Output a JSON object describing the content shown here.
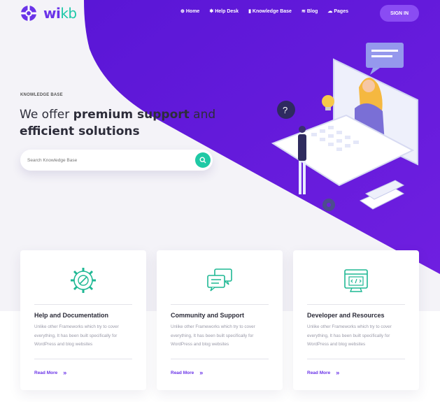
{
  "brand": {
    "name_part1": "wi",
    "name_part2": "kb",
    "primary": "#6a33e8",
    "accent": "#1dc9a8"
  },
  "nav": [
    {
      "label": "Home",
      "icon": "globe-icon"
    },
    {
      "label": "Help Desk",
      "icon": "asterisk-icon"
    },
    {
      "label": "Knowledge Base",
      "icon": "book-icon"
    },
    {
      "label": "Blog",
      "icon": "rss-icon"
    },
    {
      "label": "Pages",
      "icon": "chat-icon"
    }
  ],
  "signin_label": "SIGN IN",
  "hero": {
    "eyebrow": "KNOWLEDGE BASE",
    "line1_plain": "We offer ",
    "line1_bold": "premium support",
    "line1_tail": " and",
    "line2_bold": "efficient solutions"
  },
  "search": {
    "placeholder": "Search Knowledge Base",
    "icon": "search-icon"
  },
  "cards": [
    {
      "title": "Help and Documentation",
      "desc": "Unlike other Frameworks which try to cover everything, It has been built specifically for WordPress and blog websites",
      "link": "Read More",
      "icon": "gear-wrench-icon"
    },
    {
      "title": "Community and Support",
      "desc": "Unlike other Frameworks which try to cover everything, It has been built specifically for WordPress and blog websites",
      "link": "Read More",
      "icon": "chat-bubbles-icon"
    },
    {
      "title": "Developer and Resources",
      "desc": "Unlike other Frameworks which try to cover everything, It has been built specifically for WordPress and blog websites",
      "link": "Read More",
      "icon": "code-window-icon"
    }
  ]
}
